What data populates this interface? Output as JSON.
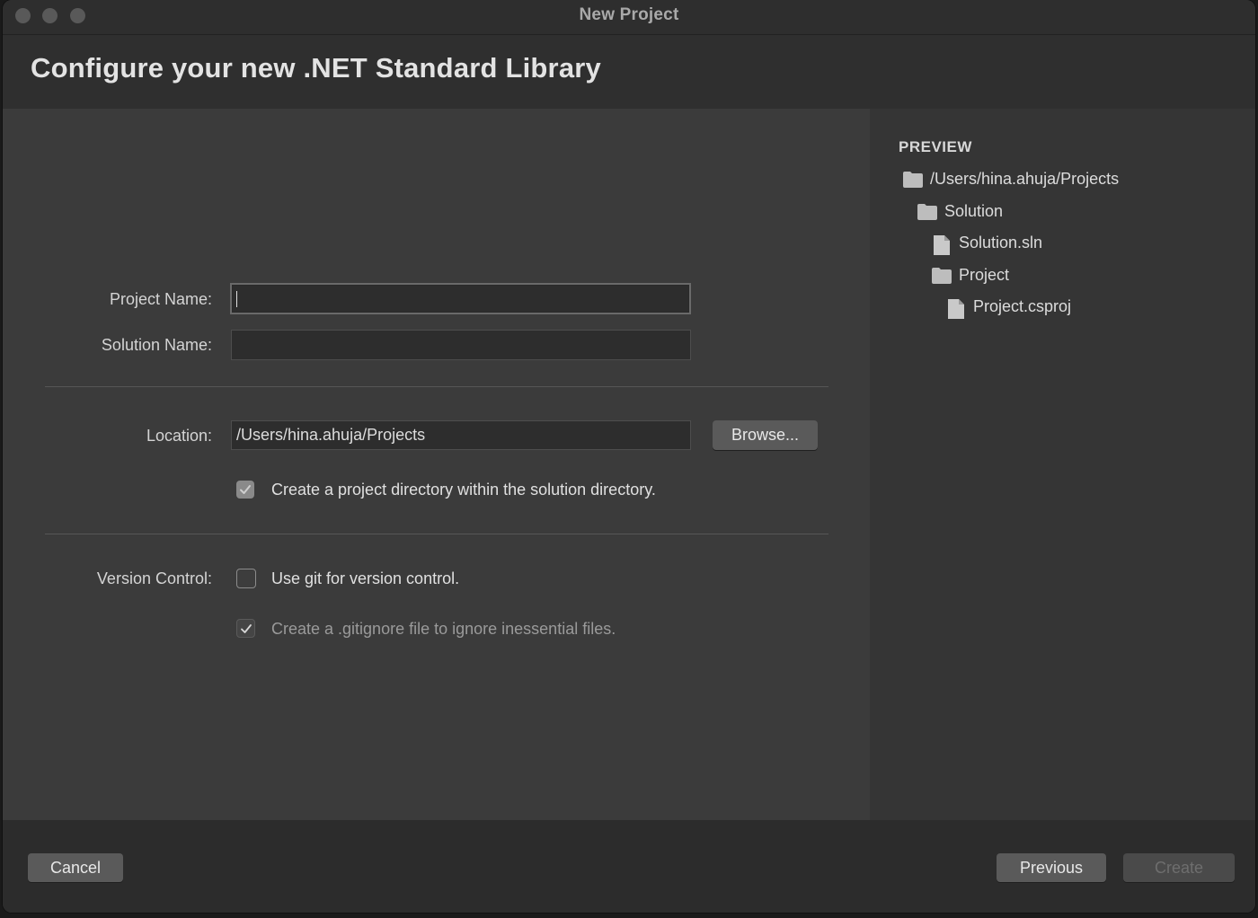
{
  "window": {
    "title": "New Project"
  },
  "header": {
    "title": "Configure your new .NET Standard Library"
  },
  "form": {
    "project_name_label": "Project Name:",
    "project_name_value": "",
    "solution_name_label": "Solution Name:",
    "solution_name_value": "",
    "location_label": "Location:",
    "location_value": "/Users/hina.ahuja/Projects",
    "browse_label": "Browse...",
    "create_dir_label": "Create a project directory within the solution directory.",
    "create_dir_checked": true,
    "version_control_label": "Version Control:",
    "use_git_label": "Use git for version control.",
    "use_git_checked": false,
    "gitignore_label": "Create a .gitignore file to ignore inessential files.",
    "gitignore_checked": true
  },
  "preview": {
    "title": "PREVIEW",
    "items": [
      {
        "label": "/Users/hina.ahuja/Projects",
        "icon": "folder-icon",
        "depth": 0
      },
      {
        "label": "Solution",
        "icon": "folder-icon",
        "depth": 1
      },
      {
        "label": "Solution.sln",
        "icon": "file-icon",
        "depth": 2
      },
      {
        "label": "Project",
        "icon": "folder-icon",
        "depth": 2
      },
      {
        "label": "Project.csproj",
        "icon": "file-icon",
        "depth": 3
      }
    ]
  },
  "footer": {
    "cancel_label": "Cancel",
    "previous_label": "Previous",
    "create_label": "Create"
  }
}
